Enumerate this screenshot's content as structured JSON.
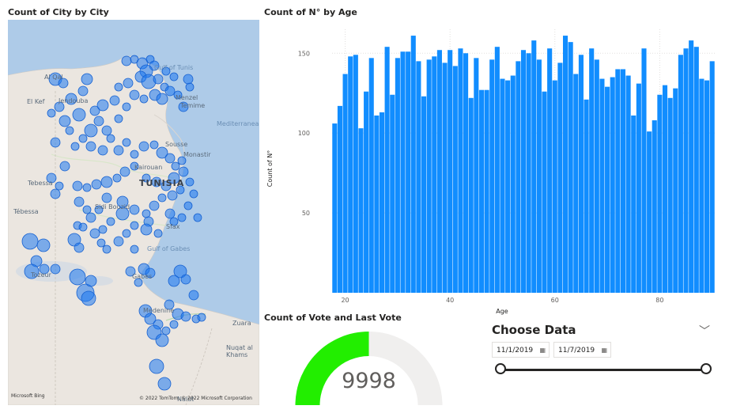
{
  "map": {
    "title": "Count of City by City",
    "labels": {
      "al_qala": "Al Qal",
      "el_kef": "El Kef",
      "jendouba": "Jendouba",
      "tebessa": "Tebessa",
      "tebessa2": "Tébessa",
      "gulf_tunis": "Gulf of Tunis",
      "menzel": "Menzel",
      "temime": "Temime",
      "sousse": "Sousse",
      "monastir": "Monastir",
      "kairouan": "Kairouan",
      "tunisia": "TUNISIA",
      "sidi_bouzid": "Sidi Bouzid",
      "sfax": "Sfax",
      "gulf_gabes": "Gulf of Gabes",
      "tozeur": "Tozeur",
      "gabes": "Gabes",
      "medenine": "Medenine",
      "zuara": "Zuara",
      "nuqat": "Nuqat al Khams",
      "mediterranean": "Mediterranean",
      "nalut": "Nalut"
    },
    "attribution_left": "Microsoft Bing",
    "attribution_right": "© 2022 TomTom, © 2022 Microsoft Corporation"
  },
  "bar": {
    "title": "Count of N° by Age"
  },
  "gauge": {
    "title": "Count of Vote and Last Vote",
    "value": "9998",
    "fill_fraction": 0.5,
    "fill_color": "#22ee00",
    "track_color": "#f0efee"
  },
  "slicer": {
    "title": "Choose Data",
    "start_date": "11/1/2019",
    "end_date": "11/7/2019",
    "chevron": "﹀",
    "calendar_icon": "calendar-icon"
  },
  "chart_data": [
    {
      "type": "bar",
      "title": "Count of N° by Age",
      "xlabel": "Age",
      "ylabel": "Count of N°",
      "color": "#118dff",
      "ylim": [
        0,
        165
      ],
      "yticks": [
        50,
        100,
        150
      ],
      "xticks": [
        20,
        40,
        60,
        80
      ],
      "grid": true,
      "x": [
        18,
        19,
        20,
        21,
        22,
        23,
        24,
        25,
        26,
        27,
        28,
        29,
        30,
        31,
        32,
        33,
        34,
        35,
        36,
        37,
        38,
        39,
        40,
        41,
        42,
        43,
        44,
        45,
        46,
        47,
        48,
        49,
        50,
        51,
        52,
        53,
        54,
        55,
        56,
        57,
        58,
        59,
        60,
        61,
        62,
        63,
        64,
        65,
        66,
        67,
        68,
        69,
        70,
        71,
        72,
        73,
        74,
        75,
        76,
        77,
        78,
        79,
        80,
        81,
        82,
        83,
        84,
        85,
        86,
        87,
        88,
        89,
        90
      ],
      "values": [
        106,
        117,
        137,
        148,
        149,
        103,
        126,
        147,
        111,
        113,
        154,
        124,
        147,
        151,
        151,
        161,
        145,
        123,
        146,
        148,
        152,
        144,
        152,
        142,
        153,
        150,
        122,
        147,
        127,
        127,
        146,
        154,
        134,
        133,
        136,
        145,
        152,
        150,
        158,
        146,
        126,
        153,
        133,
        144,
        161,
        157,
        137,
        149,
        121,
        153,
        146,
        134,
        129,
        135,
        140,
        140,
        136,
        111,
        131,
        153,
        101,
        108,
        124,
        130,
        122,
        128,
        149,
        153,
        158,
        154,
        134,
        133,
        145
      ]
    }
  ]
}
